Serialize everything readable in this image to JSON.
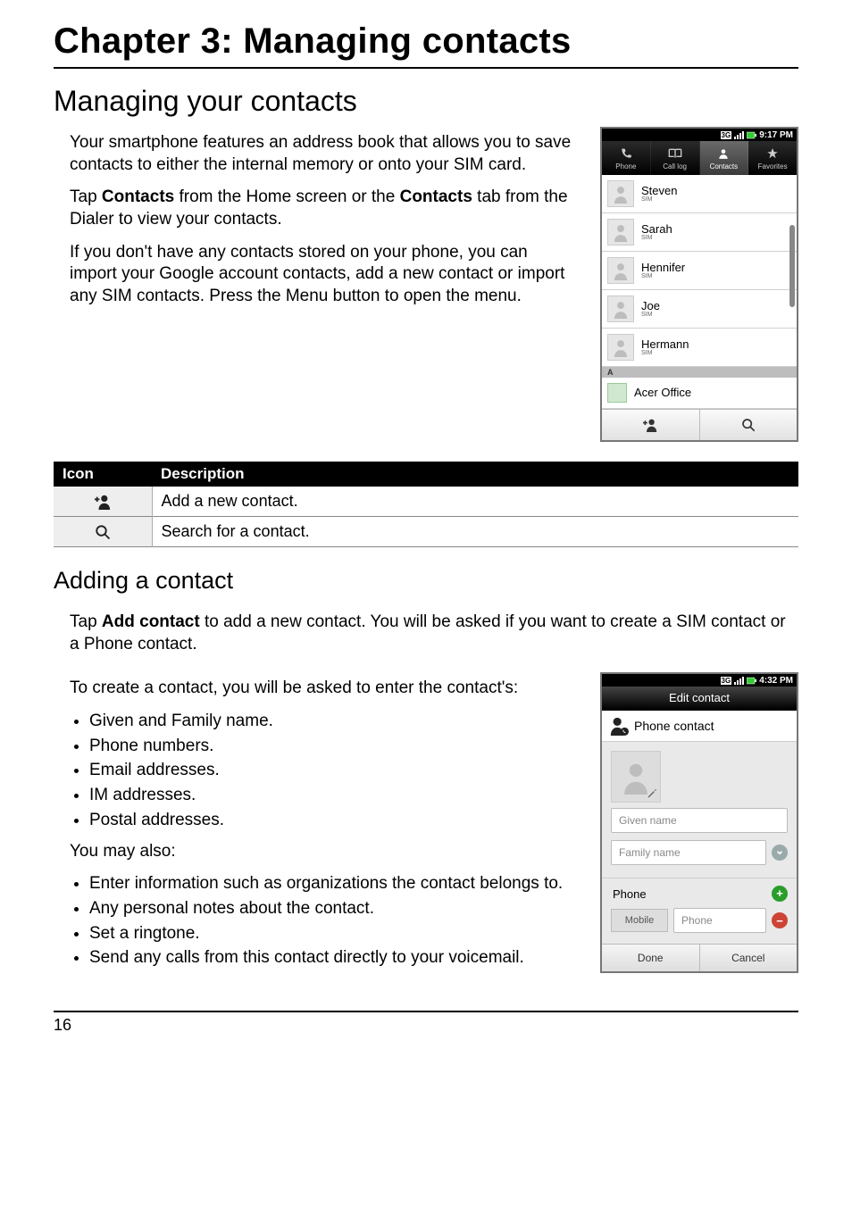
{
  "chapter_title": "Chapter 3: Managing contacts",
  "section_title": "Managing your contacts",
  "intro_para1": "Your smartphone features an address book that allows you to save contacts to either the internal memory or onto your SIM card.",
  "intro_para2_pre": "Tap ",
  "intro_para2_b1": "Contacts",
  "intro_para2_mid": " from the Home screen or the ",
  "intro_para2_b2": "Contacts",
  "intro_para2_post": " tab from the Dialer to view your contacts.",
  "intro_para3": "If you don't have any contacts stored on your phone, you can import your Google account contacts, add a new contact or import any SIM contacts. Press the Menu button to open the menu.",
  "phone1": {
    "status_time": "9:17 PM",
    "tabs": [
      "Phone",
      "Call log",
      "Contacts",
      "Favorites"
    ],
    "selected_tab_index": 2,
    "contacts": [
      {
        "name": "Steven",
        "loc": "SIM"
      },
      {
        "name": "Sarah",
        "loc": "SIM"
      },
      {
        "name": "Hennifer",
        "loc": "SIM"
      },
      {
        "name": "Joe",
        "loc": "SIM"
      },
      {
        "name": "Hermann",
        "loc": "SIM"
      }
    ],
    "section_letter": "A",
    "group_contact": "Acer Office"
  },
  "icon_table": {
    "headers": {
      "icon": "Icon",
      "desc": "Description"
    },
    "rows": {
      "add": "Add a new contact.",
      "search": "Search for a contact."
    }
  },
  "subsection_title": "Adding a contact",
  "add_para1_pre": "Tap ",
  "add_para1_b": "Add contact",
  "add_para1_post": " to add a new contact. You will be asked if you want to create a SIM contact or a Phone contact.",
  "add_para2": "To create a contact, you will be asked to enter the contact's:",
  "bullets1": [
    "Given and Family name.",
    "Phone numbers.",
    "Email addresses.",
    "IM addresses.",
    "Postal addresses."
  ],
  "add_para3": "You may also:",
  "bullets2": [
    "Enter information such as organizations the contact belongs to.",
    "Any personal notes about the contact.",
    "Set a ringtone.",
    "Send any calls from this contact directly to your voicemail."
  ],
  "phone2": {
    "status_time": "4:32 PM",
    "title": "Edit contact",
    "type_label": "Phone contact",
    "given_placeholder": "Given name",
    "family_placeholder": "Family name",
    "phone_section": "Phone",
    "phone_type": "Mobile",
    "phone_placeholder": "Phone",
    "done": "Done",
    "cancel": "Cancel"
  },
  "page_number": "16"
}
